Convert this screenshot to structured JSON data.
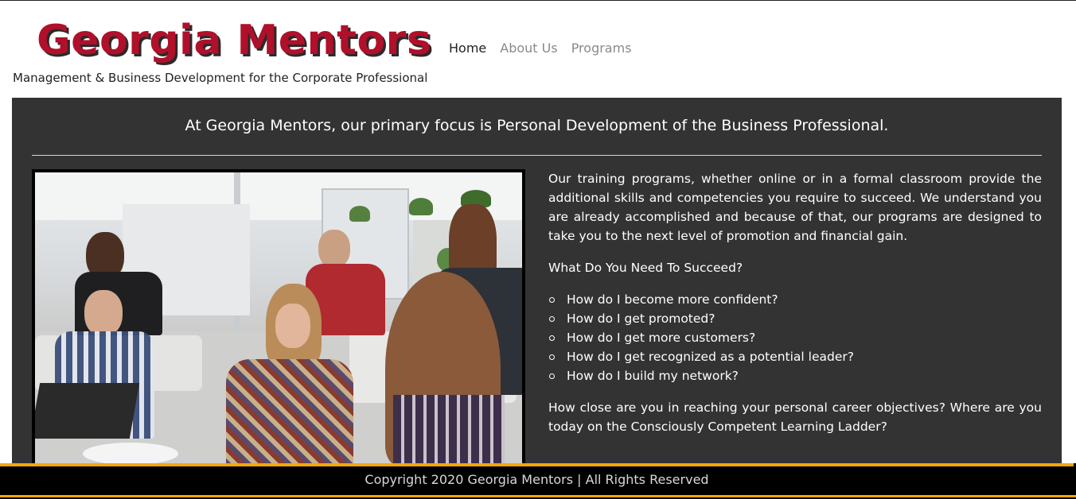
{
  "brand": {
    "title": "Georgia Mentors",
    "tagline": "Management & Business Development for the Corporate Professional",
    "title_color": "#b0102a"
  },
  "nav": {
    "items": [
      {
        "label": "Home",
        "active": true
      },
      {
        "label": "About Us",
        "active": false
      },
      {
        "label": "Programs",
        "active": false
      }
    ]
  },
  "main": {
    "headline": "At Georgia Mentors, our primary focus is Personal Development of the Business Professional.",
    "intro": "Our training programs, whether online or in a formal classroom provide the additional skills and competencies you require to succeed. We understand you are already accomplished and because of that, our programs are designed to take you to the next level of promotion and financial gain.",
    "question": "What Do You Need To Succeed?",
    "bullets": [
      "How do I become more confident?",
      "How do I get promoted?",
      "How do I get more customers?",
      "How do I get recognized as a potential leader?",
      "How do I build my network?"
    ],
    "closing": "How close are you in reaching your personal career objectives? Where are you today on the Consciously Competent Learning Ladder?",
    "panel_color": "#333333"
  },
  "footer": {
    "copyright": "Copyright 2020 Georgia Mentors | All Rights Reserved",
    "accent_color": "#f2a900"
  }
}
